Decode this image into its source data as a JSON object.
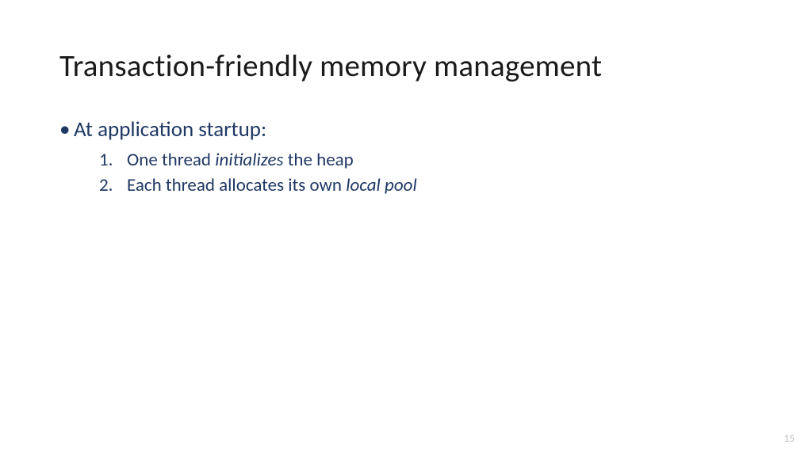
{
  "title": "Transaction-friendly memory management",
  "bullet": {
    "label": "At application startup:"
  },
  "sublist": [
    {
      "num": "1.",
      "pre": "One thread ",
      "italic": "initializes",
      "post": " the heap"
    },
    {
      "num": "2.",
      "pre": "Each thread allocates its own ",
      "italic": "local pool",
      "post": ""
    }
  ],
  "pageNumber": "15"
}
